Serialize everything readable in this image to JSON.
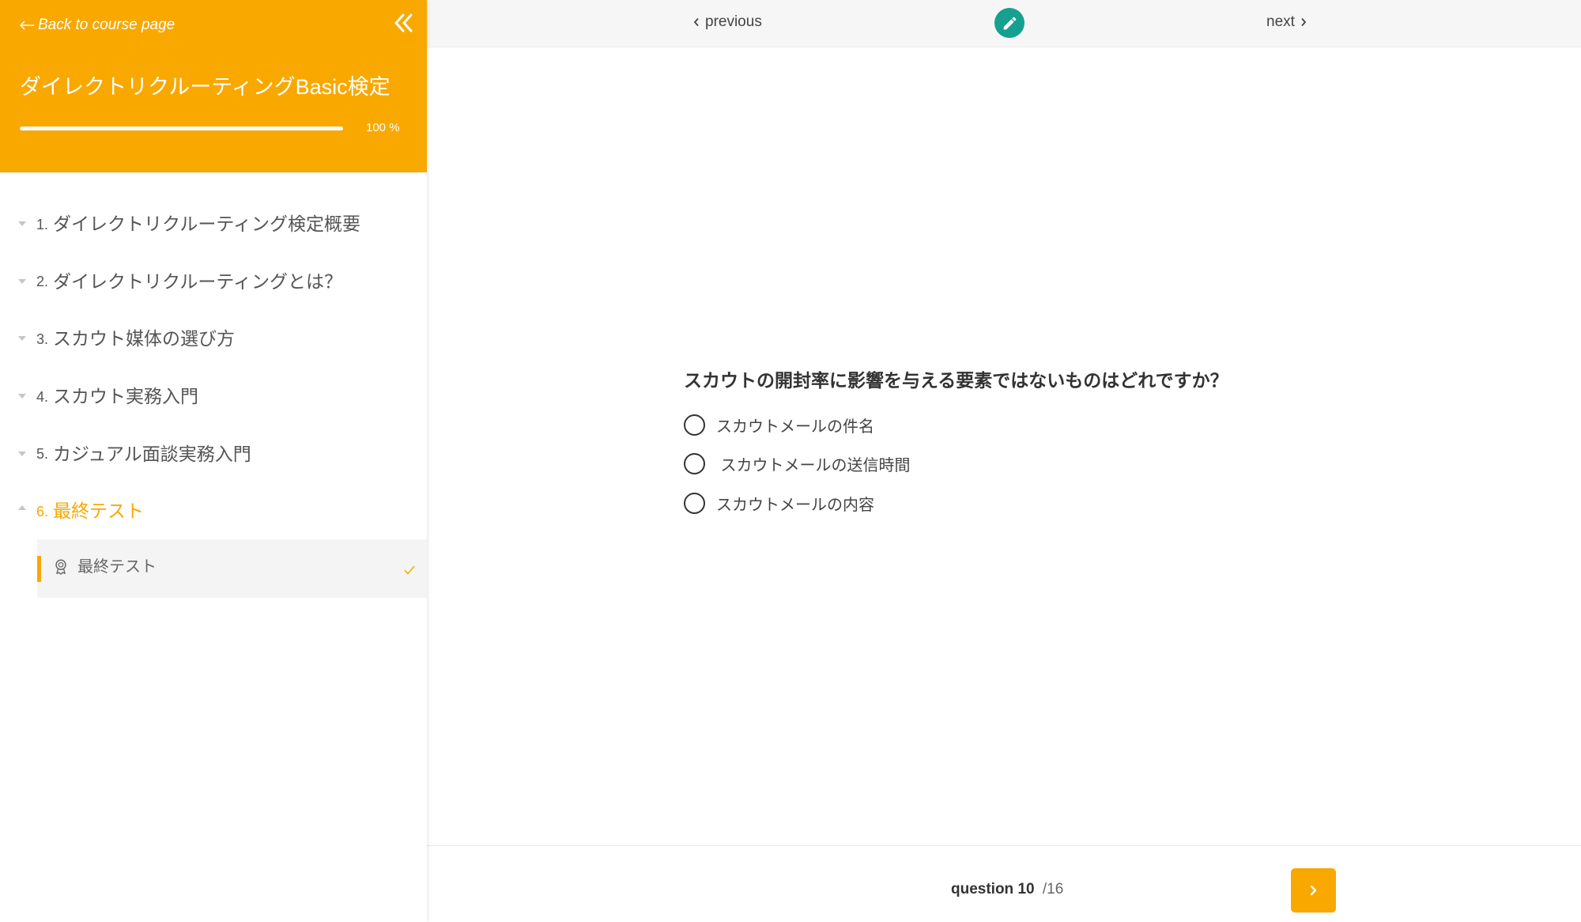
{
  "colors": {
    "accent": "#F9A800",
    "teal": "#16A08F"
  },
  "sidebar": {
    "back_link": {
      "icon": "arrow-left-icon",
      "label": "Back to course page"
    },
    "collapse_icon": "double-chevron-left-icon",
    "course_title": "ダイレクトリクルーティングBasic検定",
    "progress": {
      "percent": 100,
      "label": "100 %"
    },
    "sections": [
      {
        "number": "1.",
        "title": "ダイレクトリクルーティング検定概要",
        "expanded": false,
        "icon": "caret-down-icon"
      },
      {
        "number": "2.",
        "title": "ダイレクトリクルーティングとは？",
        "expanded": false,
        "icon": "caret-down-icon"
      },
      {
        "number": "3.",
        "title": "スカウト媒体の選び方",
        "expanded": false,
        "icon": "caret-down-icon"
      },
      {
        "number": "4.",
        "title": "スカウト実務入門",
        "expanded": false,
        "icon": "caret-down-icon"
      },
      {
        "number": "5.",
        "title": "カジュアル面談実務入門",
        "expanded": false,
        "icon": "caret-down-icon"
      },
      {
        "number": "6.",
        "title": "最終テスト",
        "expanded": true,
        "active": true,
        "icon": "caret-up-icon",
        "lessons": [
          {
            "title": "最終テスト",
            "icon": "award-icon",
            "completed": true,
            "current": true,
            "status_icon": "check-icon"
          }
        ]
      }
    ]
  },
  "topbar": {
    "previous_label": "previous",
    "previous_icon": "chevron-left-icon",
    "next_label": "next",
    "next_icon": "chevron-right-icon",
    "edit_icon": "pencil-icon"
  },
  "quiz": {
    "question": "スカウトの開封率に影響を与える要素ではないものはどれですか？",
    "options": [
      {
        "label": "スカウトメールの件名",
        "selected": false
      },
      {
        "label": " スカウトメールの送信時間",
        "selected": false
      },
      {
        "label": "スカウトメールの内容",
        "selected": false
      }
    ]
  },
  "footer": {
    "question_label": "question",
    "current": "10",
    "total": "/16",
    "next_icon": "chevron-right-icon"
  }
}
